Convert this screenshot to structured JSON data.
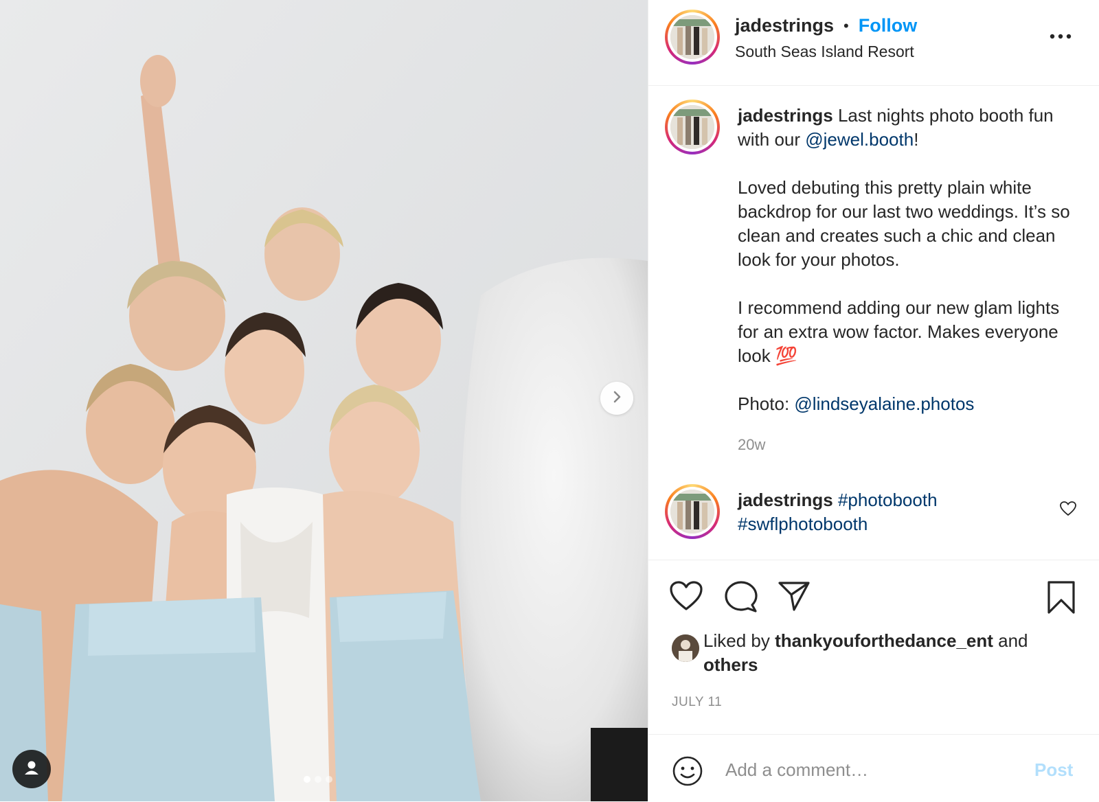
{
  "media": {
    "next_icon": "chevron-right-icon",
    "tag_icon": "user-tag-icon",
    "carousel_count": 3,
    "carousel_active": 1
  },
  "header": {
    "username": "jadestrings",
    "separator": "•",
    "follow_label": "Follow",
    "location": "South Seas Island Resort",
    "more_icon": "more-options-icon"
  },
  "caption": {
    "username": "jadestrings",
    "line1": "Last nights photo booth fun with our ",
    "mention1": "@jewel.booth",
    "line1_end": "!",
    "para2": "Loved debuting this pretty plain white backdrop for our last two weddings. It’s so clean and creates such a chic and clean look for your photos.",
    "para3": "I recommend adding our new glam lights for an extra wow factor. Makes everyone look ",
    "para3_emoji": "💯",
    "photo_label": "Photo: ",
    "mention2": "@lindseyalaine.photos",
    "time_ago": "20w"
  },
  "comment": {
    "username": "jadestrings",
    "tag1": "#photobooth",
    "tag2": "#swflphotobooth"
  },
  "likes": {
    "prefix": "Liked by ",
    "user": "thankyouforthedance_ent",
    "and": " and ",
    "others": "others"
  },
  "date": "JULY 11",
  "add_comment": {
    "placeholder": "Add a comment…",
    "post_label": "Post"
  },
  "colors": {
    "accent": "#0095f6",
    "mention": "#00376b",
    "muted": "#8e8e8e",
    "post_disabled": "#b2dffc"
  }
}
